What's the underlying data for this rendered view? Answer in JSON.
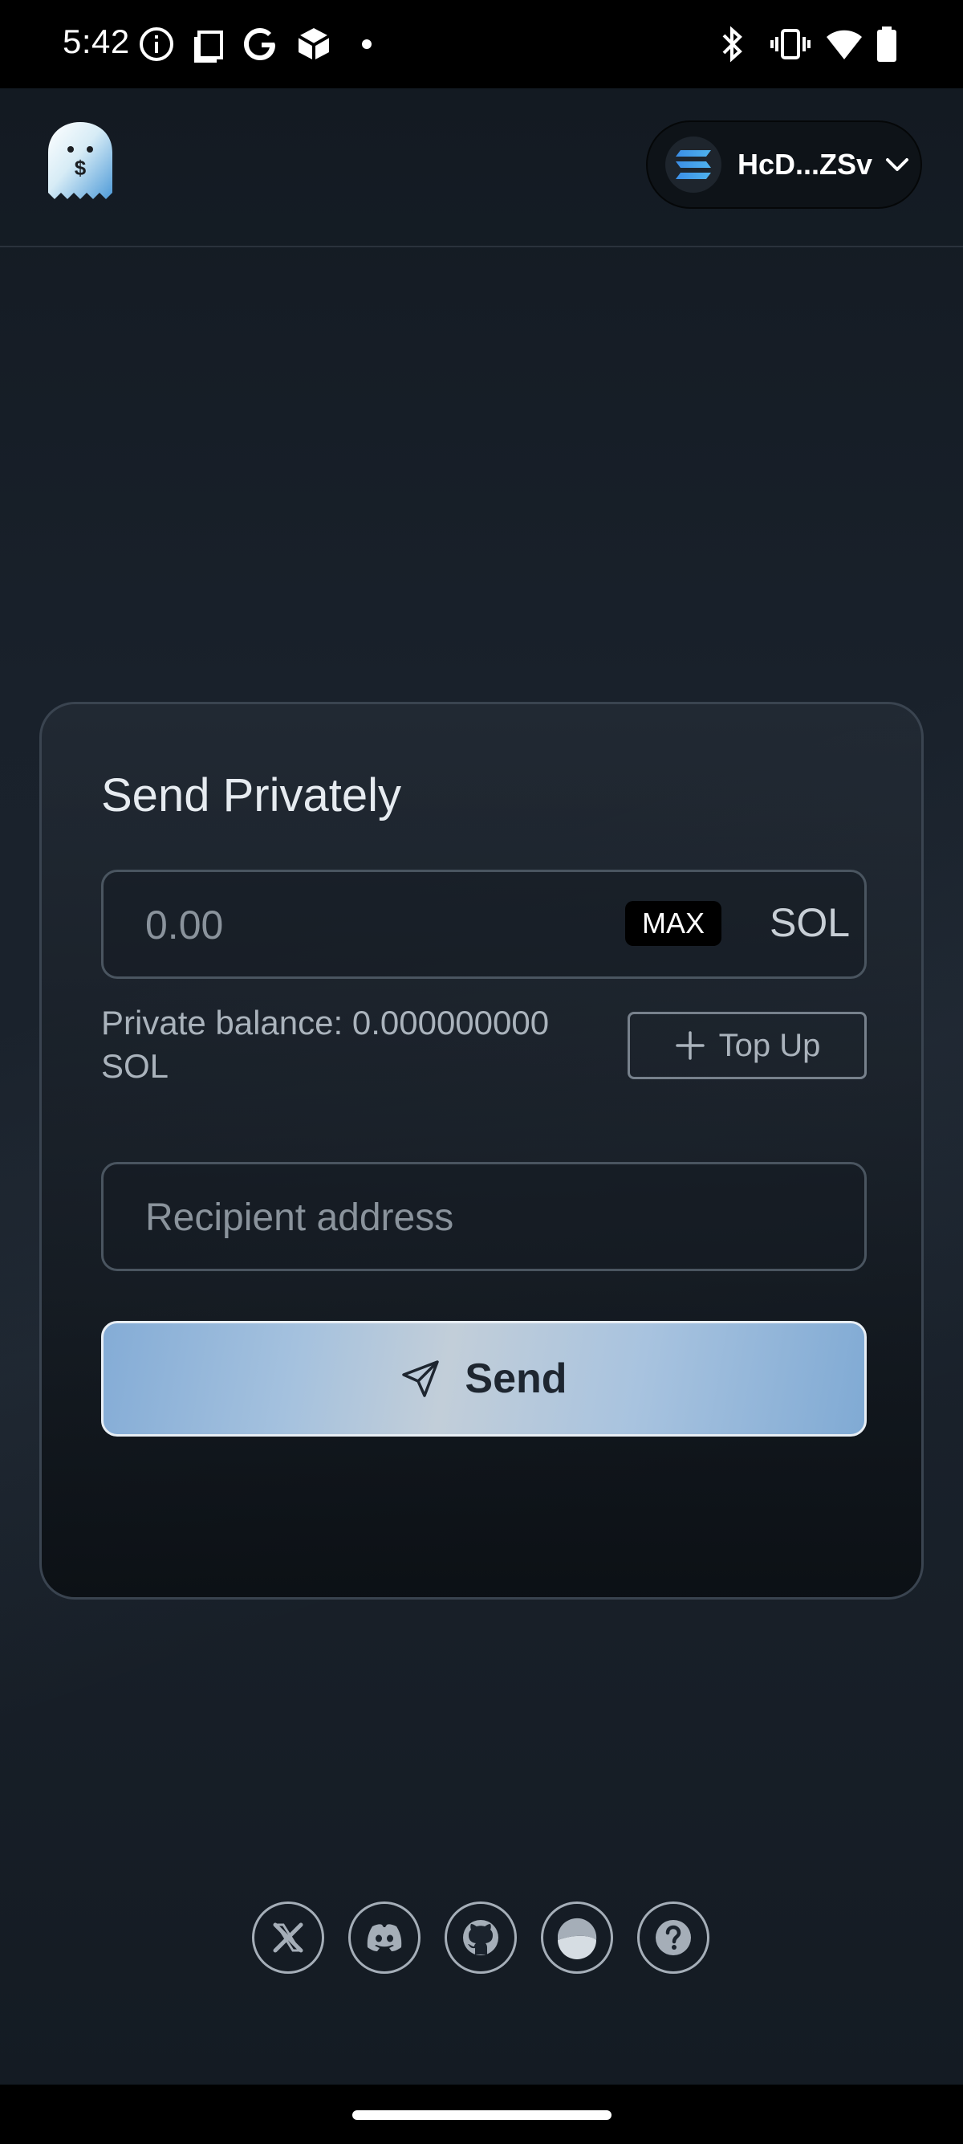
{
  "status_bar": {
    "time": "5:42",
    "icons": [
      "info-icon",
      "screenshot-icon",
      "google-icon",
      "app-icon",
      "dot-icon",
      "bluetooth-icon",
      "vibrate-icon",
      "wifi-icon",
      "battery-icon"
    ]
  },
  "header": {
    "logo": "ghost-logo",
    "wallet": {
      "label": "HcD...ZSv",
      "icon": "solana-icon"
    }
  },
  "card": {
    "title": "Send Privately",
    "amount": {
      "placeholder": "0.00",
      "max_label": "MAX",
      "unit": "SOL"
    },
    "balance_text": "Private balance: 0.000000000 SOL",
    "topup_label": "Top Up",
    "recipient": {
      "placeholder": "Recipient address"
    },
    "send_label": "Send"
  },
  "footer": {
    "social_icons": [
      "x-icon",
      "discord-icon",
      "github-icon",
      "docs-icon",
      "help-icon"
    ]
  },
  "colors": {
    "accent_gradient_start": "#84acd6",
    "accent_gradient_mid": "#c2ced9",
    "background": "#19212b"
  }
}
